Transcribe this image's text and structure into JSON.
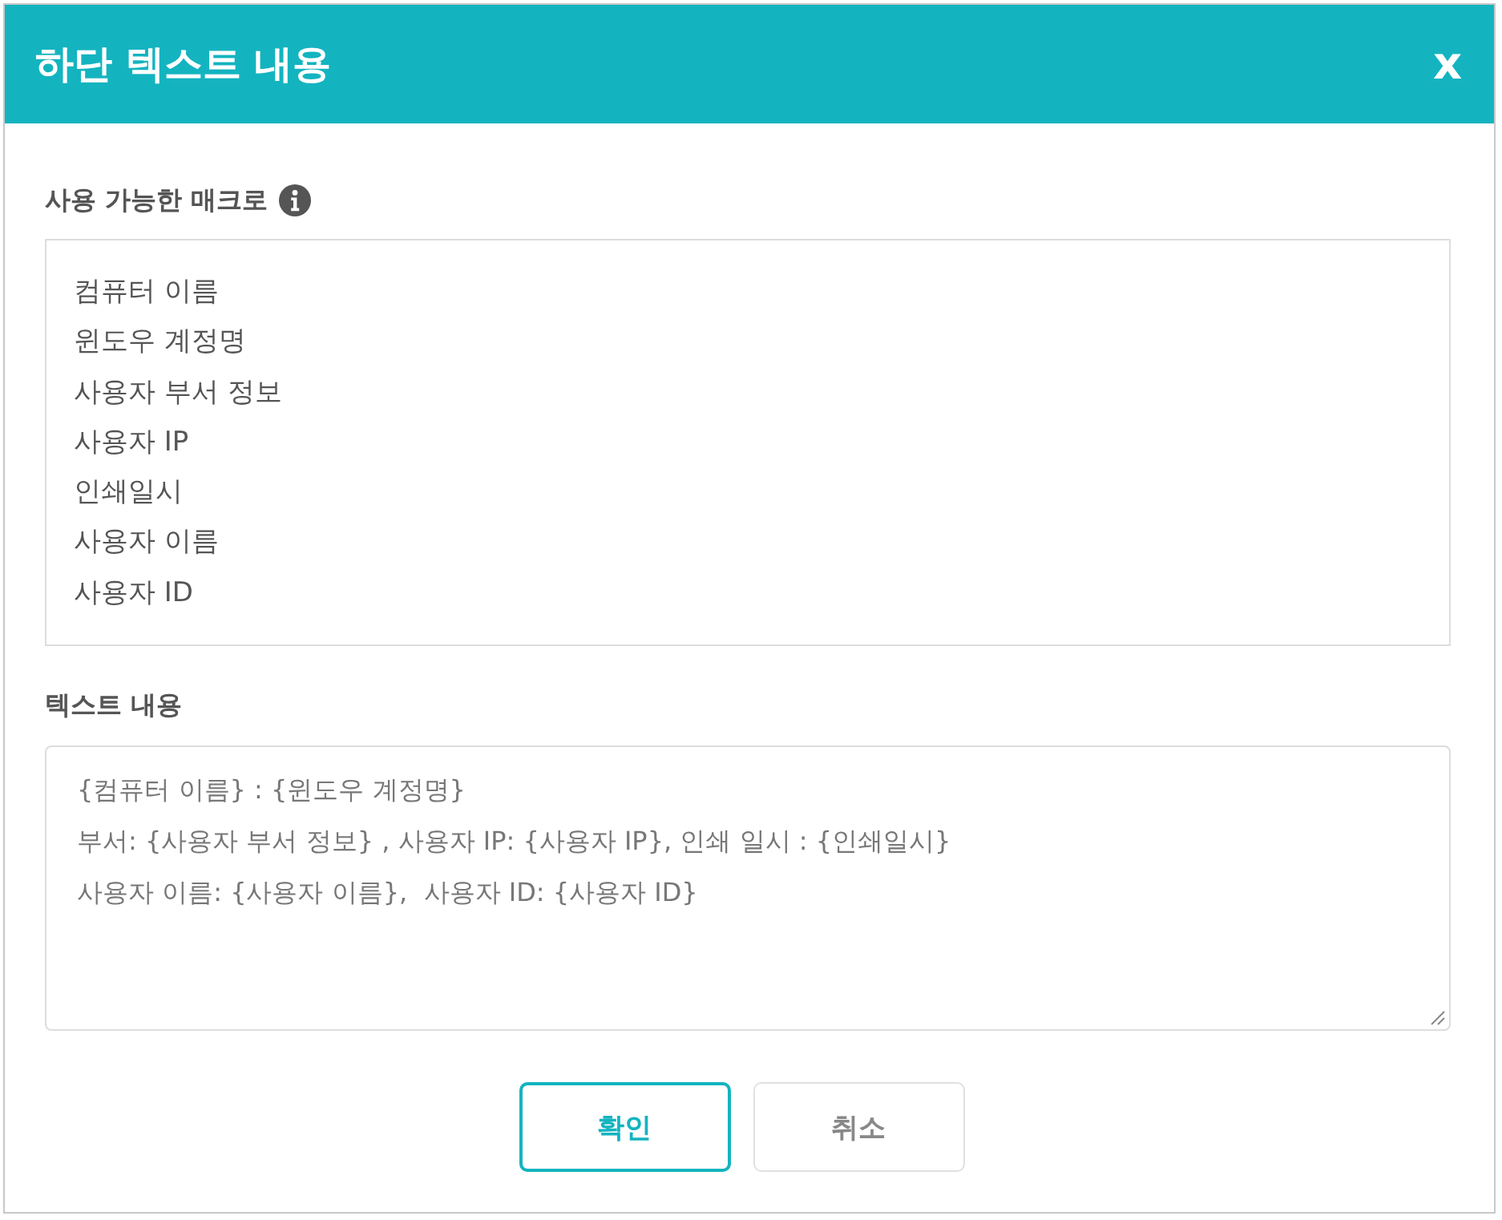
{
  "dialog": {
    "title": "하단 텍스트 내용",
    "close": "x"
  },
  "macros": {
    "label": "사용 가능한 매크로",
    "items": [
      "컴퓨터 이름",
      "윈도우 계정명",
      "사용자 부서 정보",
      "사용자 IP",
      "인쇄일시",
      "사용자 이름",
      "사용자 ID"
    ]
  },
  "text_content": {
    "label": "텍스트 내용",
    "value": "{컴퓨터 이름} : {윈도우 계정명}\n부서: {사용자 부서 정보} , 사용자 IP: {사용자 IP}, 인쇄 일시 : {인쇄일시}\n사용자 이름: {사용자 이름},  사용자 ID: {사용자 ID}"
  },
  "buttons": [
    {
      "label": "확인",
      "kind": "primary"
    },
    {
      "label": "취소",
      "kind": "secondary"
    }
  ]
}
